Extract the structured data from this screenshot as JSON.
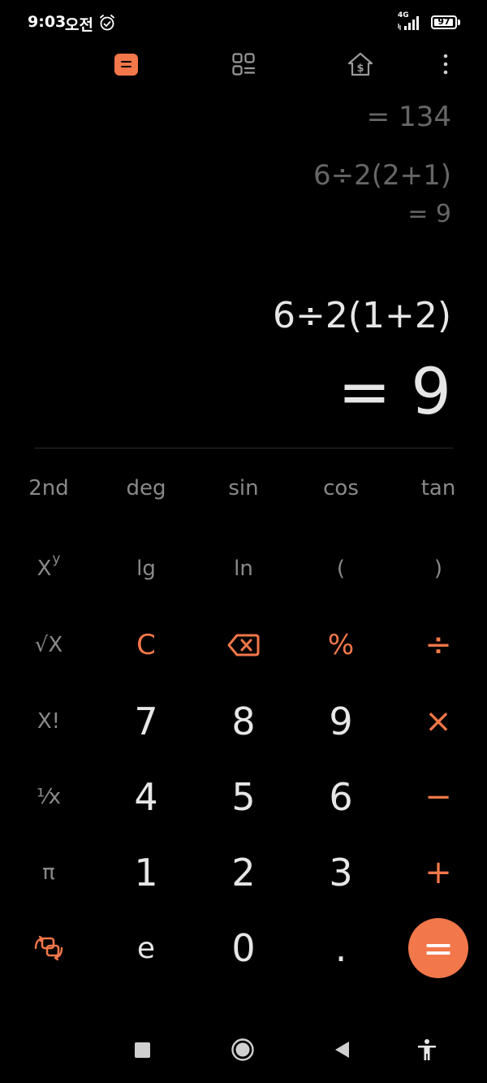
{
  "status_bar": {
    "time": "9:03",
    "ampm": "오전",
    "network": "4G",
    "battery": "97",
    "battery_level": 0.97,
    "icons": [
      "alarm-icon",
      "signal-icon",
      "battery-icon"
    ]
  },
  "top_bar": {
    "icons": [
      "calculator-mode-icon",
      "converter-grid-icon",
      "currency-house-icon",
      "more-vert-icon"
    ],
    "more": "⋮"
  },
  "display": {
    "history": [
      {
        "result": "= 134"
      },
      {
        "expression": "6÷2(2+1)",
        "result": "= 9"
      }
    ],
    "current_expression": "6÷2(1+2)",
    "current_result": "= 9"
  },
  "keypad": {
    "row1": [
      "2nd",
      "deg",
      "sin",
      "cos",
      "tan"
    ],
    "row2": {
      "xy_base": "X",
      "xy_sup": "y",
      "lg": "lg",
      "ln": "ln",
      "lparen": "(",
      "rparen": ")"
    },
    "row3": {
      "sqrt": "√X",
      "clear": "C",
      "percent": "%",
      "divide": "÷"
    },
    "row4": {
      "fact": "X!",
      "seven": "7",
      "eight": "8",
      "nine": "9",
      "multiply": "×"
    },
    "row5": {
      "recip": "⅟x",
      "four": "4",
      "five": "5",
      "six": "6",
      "minus": "−"
    },
    "row6": {
      "pi": "π",
      "one": "1",
      "two": "2",
      "three": "3",
      "plus": "+"
    },
    "row7": {
      "e": "e",
      "zero": "0",
      "dot": ".",
      "equals": "="
    }
  },
  "colors": {
    "accent": "#f2774a",
    "background": "#000000",
    "history_text": "#666666",
    "scientific_text": "#8a8a8a"
  }
}
